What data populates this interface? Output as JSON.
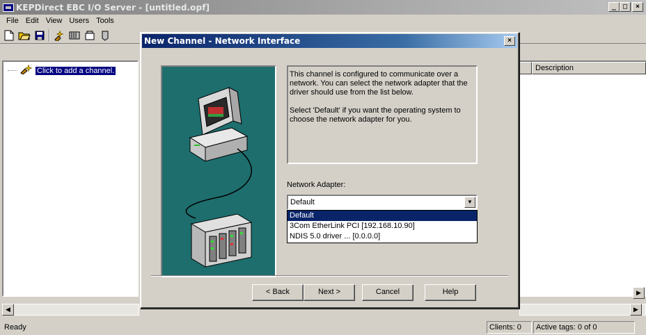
{
  "window": {
    "title": "KEPDirect EBC I/O Server - [untitled.opf]",
    "minimize": "_",
    "maximize": "□",
    "close": "×"
  },
  "menu": [
    "File",
    "Edit",
    "View",
    "Users",
    "Tools"
  ],
  "tree": {
    "item_label": "Click to add a channel."
  },
  "list": {
    "column_description": "Description"
  },
  "status": {
    "text": "Ready",
    "clients": "Clients:  0",
    "active_tags": "Active tags:  0 of 0"
  },
  "dialog": {
    "title": "New Channel - Network Interface",
    "close": "×",
    "info_paragraph_1": "This channel is configured to communicate over a network.  You can select the network adapter that the driver should use from the list below.",
    "info_paragraph_2": "Select 'Default' if you want the operating system to choose the network adapter for you.",
    "adapter_label": "Network Adapter:",
    "adapter_selected": "Default",
    "adapter_options": [
      "Default",
      "3Com EtherLink PCI [192.168.10.90]",
      "NDIS 5.0 driver  ... [0.0.0.0]"
    ],
    "buttons": {
      "back": "< Back",
      "next": "Next >",
      "cancel": "Cancel",
      "help": "Help"
    }
  },
  "colors": {
    "dialog_title_bg": "#0a246a",
    "illustration_bg": "#1e6e6e",
    "selection": "#0a246a"
  }
}
